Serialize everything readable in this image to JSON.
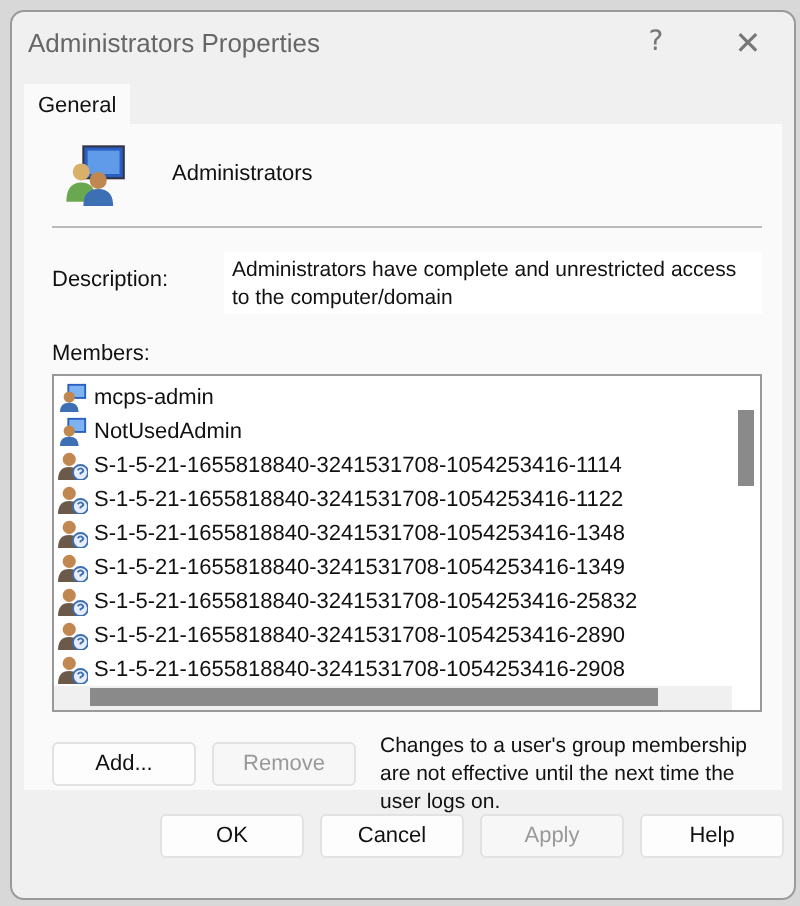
{
  "window": {
    "title": "Administrators Properties",
    "help_glyph": "?",
    "close_glyph": "✕"
  },
  "tabs": [
    {
      "label": "General",
      "selected": true
    }
  ],
  "group": {
    "name": "Administrators"
  },
  "description": {
    "label": "Description:",
    "value": "Administrators have complete and unrestricted access to the computer/domain"
  },
  "members": {
    "label": "Members:",
    "items": [
      {
        "kind": "user",
        "name": "mcps-admin"
      },
      {
        "kind": "user",
        "name": "NotUsedAdmin"
      },
      {
        "kind": "unknown",
        "name": "S-1-5-21-1655818840-3241531708-1054253416-1114"
      },
      {
        "kind": "unknown",
        "name": "S-1-5-21-1655818840-3241531708-1054253416-1122"
      },
      {
        "kind": "unknown",
        "name": "S-1-5-21-1655818840-3241531708-1054253416-1348"
      },
      {
        "kind": "unknown",
        "name": "S-1-5-21-1655818840-3241531708-1054253416-1349"
      },
      {
        "kind": "unknown",
        "name": "S-1-5-21-1655818840-3241531708-1054253416-25832"
      },
      {
        "kind": "unknown",
        "name": "S-1-5-21-1655818840-3241531708-1054253416-2890"
      },
      {
        "kind": "unknown",
        "name": "S-1-5-21-1655818840-3241531708-1054253416-2908"
      }
    ]
  },
  "member_buttons": [
    {
      "label": "Add...",
      "disabled": false
    },
    {
      "label": "Remove",
      "disabled": true
    }
  ],
  "note": "Changes to a user's group membership are not effective until the next time the user logs on.",
  "buttons": [
    {
      "label": "OK",
      "disabled": false
    },
    {
      "label": "Cancel",
      "disabled": false
    },
    {
      "label": "Apply",
      "disabled": true
    },
    {
      "label": "Help",
      "disabled": false
    }
  ]
}
